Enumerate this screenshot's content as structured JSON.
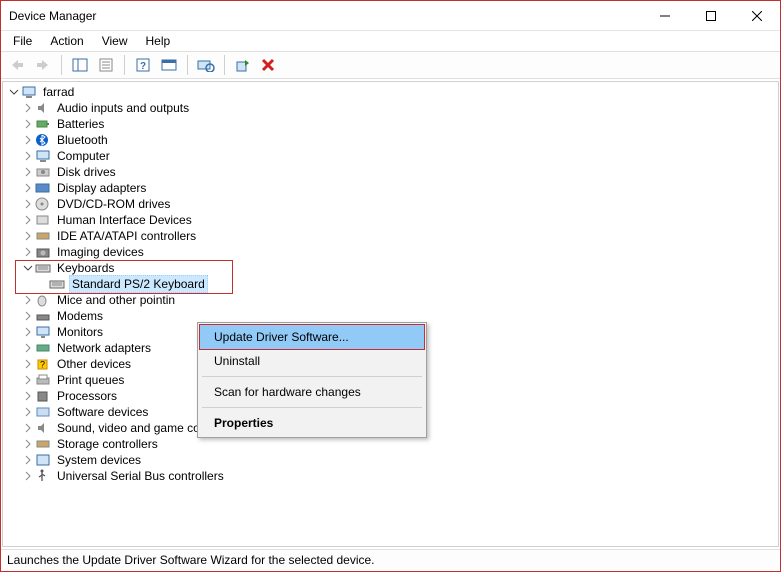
{
  "window": {
    "title": "Device Manager"
  },
  "menubar": {
    "file": "File",
    "action": "Action",
    "view": "View",
    "help": "Help"
  },
  "tree": {
    "root": "farrad",
    "items": [
      {
        "label": "Audio inputs and outputs"
      },
      {
        "label": "Batteries"
      },
      {
        "label": "Bluetooth"
      },
      {
        "label": "Computer"
      },
      {
        "label": "Disk drives"
      },
      {
        "label": "Display adapters"
      },
      {
        "label": "DVD/CD-ROM drives"
      },
      {
        "label": "Human Interface Devices"
      },
      {
        "label": "IDE ATA/ATAPI controllers"
      },
      {
        "label": "Imaging devices"
      },
      {
        "label": "Keyboards",
        "expanded": true,
        "children": [
          {
            "label": "Standard PS/2 Keyboard",
            "selected": true
          }
        ]
      },
      {
        "label": "Mice and other pointing devices",
        "truncated": "Mice and other pointin"
      },
      {
        "label": "Modems"
      },
      {
        "label": "Monitors"
      },
      {
        "label": "Network adapters"
      },
      {
        "label": "Other devices"
      },
      {
        "label": "Print queues"
      },
      {
        "label": "Processors"
      },
      {
        "label": "Software devices"
      },
      {
        "label": "Sound, video and game controllers"
      },
      {
        "label": "Storage controllers"
      },
      {
        "label": "System devices"
      },
      {
        "label": "Universal Serial Bus controllers"
      }
    ]
  },
  "context_menu": {
    "update": "Update Driver Software...",
    "uninstall": "Uninstall",
    "scan": "Scan for hardware changes",
    "properties": "Properties"
  },
  "statusbar": {
    "text": "Launches the Update Driver Software Wizard for the selected device."
  }
}
